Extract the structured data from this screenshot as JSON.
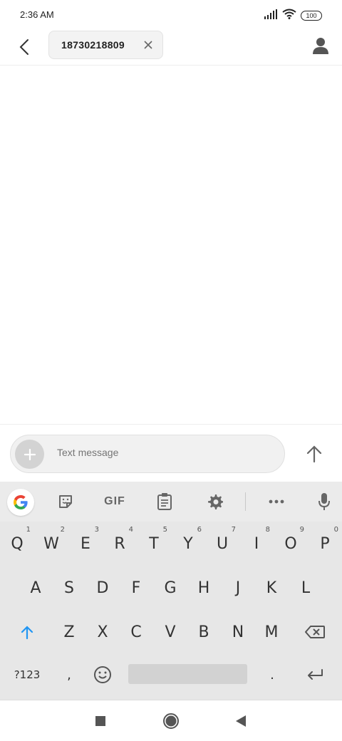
{
  "status_bar": {
    "time": "2:36 AM",
    "battery": "100"
  },
  "header": {
    "recipient_chip": "18730218809"
  },
  "compose": {
    "placeholder": "Text message"
  },
  "keyboard": {
    "toolbar": {
      "gif_label": "GIF"
    },
    "row1": [
      {
        "key": "Q",
        "hint": "1"
      },
      {
        "key": "W",
        "hint": "2"
      },
      {
        "key": "E",
        "hint": "3"
      },
      {
        "key": "R",
        "hint": "4"
      },
      {
        "key": "T",
        "hint": "5"
      },
      {
        "key": "Y",
        "hint": "6"
      },
      {
        "key": "U",
        "hint": "7"
      },
      {
        "key": "I",
        "hint": "8"
      },
      {
        "key": "O",
        "hint": "9"
      },
      {
        "key": "P",
        "hint": "0"
      }
    ],
    "row2": [
      "A",
      "S",
      "D",
      "F",
      "G",
      "H",
      "J",
      "K",
      "L"
    ],
    "row3": [
      "Z",
      "X",
      "C",
      "V",
      "B",
      "N",
      "M"
    ],
    "row4": {
      "symbols": "?123",
      "comma": ",",
      "period": "."
    }
  },
  "colors": {
    "accent": "#2196f3",
    "keyboard_bg": "#e7e7e7"
  }
}
